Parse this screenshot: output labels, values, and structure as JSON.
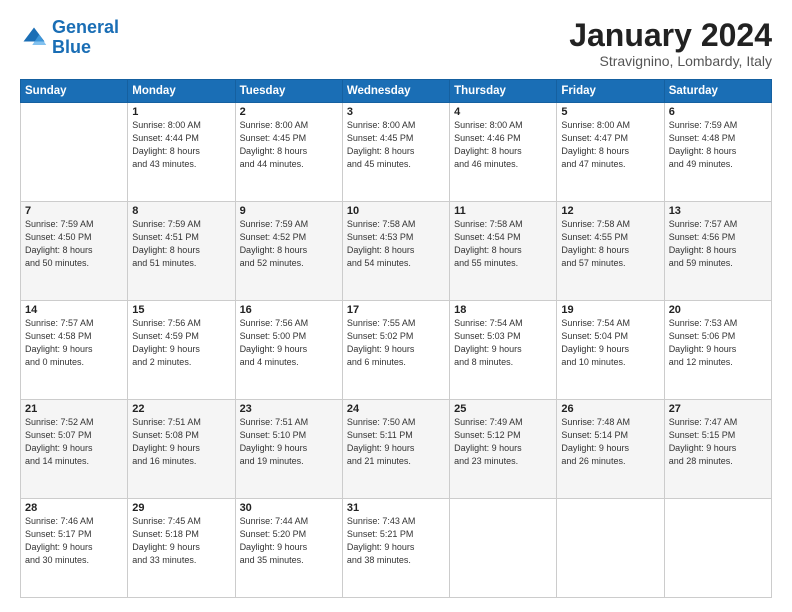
{
  "header": {
    "logo_line1": "General",
    "logo_line2": "Blue",
    "month": "January 2024",
    "location": "Stravignino, Lombardy, Italy"
  },
  "days_of_week": [
    "Sunday",
    "Monday",
    "Tuesday",
    "Wednesday",
    "Thursday",
    "Friday",
    "Saturday"
  ],
  "weeks": [
    [
      {
        "num": "",
        "info": ""
      },
      {
        "num": "1",
        "info": "Sunrise: 8:00 AM\nSunset: 4:44 PM\nDaylight: 8 hours\nand 43 minutes."
      },
      {
        "num": "2",
        "info": "Sunrise: 8:00 AM\nSunset: 4:45 PM\nDaylight: 8 hours\nand 44 minutes."
      },
      {
        "num": "3",
        "info": "Sunrise: 8:00 AM\nSunset: 4:45 PM\nDaylight: 8 hours\nand 45 minutes."
      },
      {
        "num": "4",
        "info": "Sunrise: 8:00 AM\nSunset: 4:46 PM\nDaylight: 8 hours\nand 46 minutes."
      },
      {
        "num": "5",
        "info": "Sunrise: 8:00 AM\nSunset: 4:47 PM\nDaylight: 8 hours\nand 47 minutes."
      },
      {
        "num": "6",
        "info": "Sunrise: 7:59 AM\nSunset: 4:48 PM\nDaylight: 8 hours\nand 49 minutes."
      }
    ],
    [
      {
        "num": "7",
        "info": "Sunrise: 7:59 AM\nSunset: 4:50 PM\nDaylight: 8 hours\nand 50 minutes."
      },
      {
        "num": "8",
        "info": "Sunrise: 7:59 AM\nSunset: 4:51 PM\nDaylight: 8 hours\nand 51 minutes."
      },
      {
        "num": "9",
        "info": "Sunrise: 7:59 AM\nSunset: 4:52 PM\nDaylight: 8 hours\nand 52 minutes."
      },
      {
        "num": "10",
        "info": "Sunrise: 7:58 AM\nSunset: 4:53 PM\nDaylight: 8 hours\nand 54 minutes."
      },
      {
        "num": "11",
        "info": "Sunrise: 7:58 AM\nSunset: 4:54 PM\nDaylight: 8 hours\nand 55 minutes."
      },
      {
        "num": "12",
        "info": "Sunrise: 7:58 AM\nSunset: 4:55 PM\nDaylight: 8 hours\nand 57 minutes."
      },
      {
        "num": "13",
        "info": "Sunrise: 7:57 AM\nSunset: 4:56 PM\nDaylight: 8 hours\nand 59 minutes."
      }
    ],
    [
      {
        "num": "14",
        "info": "Sunrise: 7:57 AM\nSunset: 4:58 PM\nDaylight: 9 hours\nand 0 minutes."
      },
      {
        "num": "15",
        "info": "Sunrise: 7:56 AM\nSunset: 4:59 PM\nDaylight: 9 hours\nand 2 minutes."
      },
      {
        "num": "16",
        "info": "Sunrise: 7:56 AM\nSunset: 5:00 PM\nDaylight: 9 hours\nand 4 minutes."
      },
      {
        "num": "17",
        "info": "Sunrise: 7:55 AM\nSunset: 5:02 PM\nDaylight: 9 hours\nand 6 minutes."
      },
      {
        "num": "18",
        "info": "Sunrise: 7:54 AM\nSunset: 5:03 PM\nDaylight: 9 hours\nand 8 minutes."
      },
      {
        "num": "19",
        "info": "Sunrise: 7:54 AM\nSunset: 5:04 PM\nDaylight: 9 hours\nand 10 minutes."
      },
      {
        "num": "20",
        "info": "Sunrise: 7:53 AM\nSunset: 5:06 PM\nDaylight: 9 hours\nand 12 minutes."
      }
    ],
    [
      {
        "num": "21",
        "info": "Sunrise: 7:52 AM\nSunset: 5:07 PM\nDaylight: 9 hours\nand 14 minutes."
      },
      {
        "num": "22",
        "info": "Sunrise: 7:51 AM\nSunset: 5:08 PM\nDaylight: 9 hours\nand 16 minutes."
      },
      {
        "num": "23",
        "info": "Sunrise: 7:51 AM\nSunset: 5:10 PM\nDaylight: 9 hours\nand 19 minutes."
      },
      {
        "num": "24",
        "info": "Sunrise: 7:50 AM\nSunset: 5:11 PM\nDaylight: 9 hours\nand 21 minutes."
      },
      {
        "num": "25",
        "info": "Sunrise: 7:49 AM\nSunset: 5:12 PM\nDaylight: 9 hours\nand 23 minutes."
      },
      {
        "num": "26",
        "info": "Sunrise: 7:48 AM\nSunset: 5:14 PM\nDaylight: 9 hours\nand 26 minutes."
      },
      {
        "num": "27",
        "info": "Sunrise: 7:47 AM\nSunset: 5:15 PM\nDaylight: 9 hours\nand 28 minutes."
      }
    ],
    [
      {
        "num": "28",
        "info": "Sunrise: 7:46 AM\nSunset: 5:17 PM\nDaylight: 9 hours\nand 30 minutes."
      },
      {
        "num": "29",
        "info": "Sunrise: 7:45 AM\nSunset: 5:18 PM\nDaylight: 9 hours\nand 33 minutes."
      },
      {
        "num": "30",
        "info": "Sunrise: 7:44 AM\nSunset: 5:20 PM\nDaylight: 9 hours\nand 35 minutes."
      },
      {
        "num": "31",
        "info": "Sunrise: 7:43 AM\nSunset: 5:21 PM\nDaylight: 9 hours\nand 38 minutes."
      },
      {
        "num": "",
        "info": ""
      },
      {
        "num": "",
        "info": ""
      },
      {
        "num": "",
        "info": ""
      }
    ]
  ]
}
